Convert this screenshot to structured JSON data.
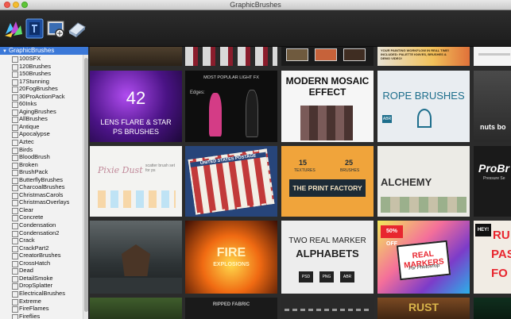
{
  "window": {
    "title": "GraphicBrushes"
  },
  "toolbar": {
    "buttons": [
      "palette-icon",
      "brush-app-icon",
      "preview-icon",
      "eraser-icon"
    ]
  },
  "sidebar": {
    "root_label": "GraphicBrushes",
    "items": [
      "100SFX",
      "120Brushes",
      "150Brushes",
      "17Stunning",
      "20FogBrushes",
      "30ProActionPack",
      "60Inks",
      "AgingBrushes",
      "AllBrushes",
      "Antique",
      "Apocalypse",
      "Aztec",
      "Birds",
      "BloodBrush",
      "Broken",
      "BrushPack",
      "ButterflyBrushes",
      "CharcoalBrushes",
      "ChristmasCarols",
      "ChristmasOverlays",
      "Clear",
      "Concrete",
      "Condensation",
      "Condensation2",
      "Crack",
      "CrackPart2",
      "CreatorBrushes",
      "CrossHatch",
      "Dead",
      "DetailSmoke",
      "DropSplatter",
      "ElectricalBrushes",
      "Extreme",
      "FireFlames",
      "Fireflies"
    ]
  },
  "tiles": {
    "row0": [
      "",
      "",
      "",
      "YOUR PAINTING WORKFLOW IN REAL TIME! INCLUDED: PALETTE KNIVES, BRUSHES & DEMO VIDEO!",
      ""
    ],
    "lens": {
      "number": "42",
      "line1": "LENS FLARE & STAR",
      "line2": "PS BRUSHES"
    },
    "light": {
      "header": "MOST POPULAR LIGHT FX",
      "edges": "Edges:"
    },
    "mosaic": {
      "line1": "MODERN MOSAIC",
      "line2": "EFFECT"
    },
    "rope": {
      "title": "ROPE BRUSHES",
      "sub": "ABR"
    },
    "nuts": "nuts bo",
    "pixie": {
      "title": "Pixie Dust",
      "sub": "scatter brush set for ps"
    },
    "stamp": "UNITED STATES POSTAGE",
    "print": {
      "t1": "15",
      "t2": "25",
      "l1": "TEXTURES",
      "l2": "BRUSHES",
      "title": "THE PRINT FACTORY"
    },
    "alchemy": "ALCHEMY",
    "probr": {
      "title": "ProBr",
      "sub": "Pressure Se"
    },
    "fire": {
      "title": "FIRE",
      "sub": "EXPLOSIONS"
    },
    "marker": {
      "title": "TWO REAL MARKER",
      "big": "ALPHABETS",
      "formats": [
        "PSD",
        "PNG",
        "ABR"
      ]
    },
    "markers": {
      "badge": "50% OFF",
      "title": "REAL MARKERS",
      "sub": "For Photoshop"
    },
    "paste": {
      "hey": "HEY!",
      "l1": "RU",
      "l2": "PAS",
      "l3": "FO"
    },
    "ripped": "RIPPED FABRIC",
    "rust": "RUST"
  },
  "colors": {
    "accent": "#3b78d8",
    "sidebar_bg": "#f2f2f2",
    "grid_bg": "#2b2b2b"
  }
}
